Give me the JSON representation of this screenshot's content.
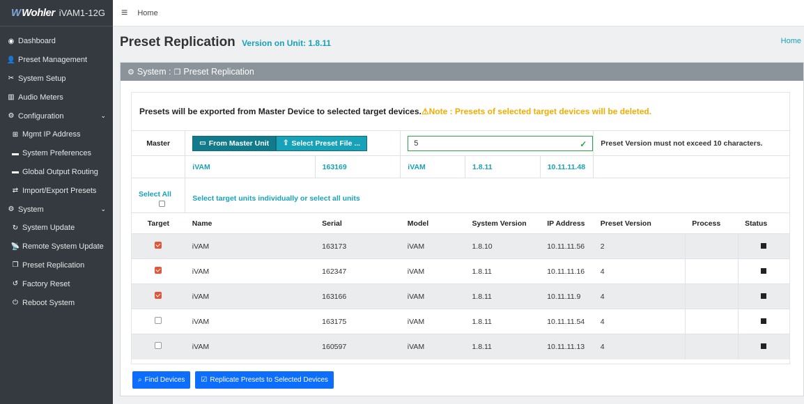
{
  "brand": {
    "logo_mark": "W",
    "logo_text": "Wohler",
    "unit": "iVAM1-12G"
  },
  "sidebar": {
    "items": [
      {
        "icon": "◉",
        "label": "Dashboard"
      },
      {
        "icon": "👤",
        "label": "Preset Management"
      },
      {
        "icon": "✂",
        "label": "System Setup"
      },
      {
        "icon": "▥",
        "label": "Audio Meters"
      },
      {
        "icon": "⚙",
        "label": "Configuration",
        "caret": "⌄"
      },
      {
        "icon": "⊞",
        "label": "Mgmt IP Address"
      },
      {
        "icon": "▬",
        "label": "System Preferences"
      },
      {
        "icon": "▬",
        "label": "Global Output Routing"
      },
      {
        "icon": "⇄",
        "label": "Import/Export Presets"
      },
      {
        "icon": "⚙",
        "label": "System",
        "caret": "⌄"
      },
      {
        "icon": "↻",
        "label": "System Update"
      },
      {
        "icon": "📡",
        "label": "Remote System Update"
      },
      {
        "icon": "❐",
        "label": "Preset Replication"
      },
      {
        "icon": "↺",
        "label": "Factory Reset"
      },
      {
        "icon": "⏻",
        "label": "Reboot System"
      }
    ]
  },
  "topbar": {
    "menu_icon": "≡",
    "breadcrumb": "Home"
  },
  "page": {
    "title": "Preset Replication",
    "version_label": "Version on Unit: 1.8.11",
    "home_link": "Home"
  },
  "card": {
    "header_prefix": "System :",
    "header_title": "Preset Replication"
  },
  "notice": {
    "text": "Presets will be exported from Master Device to selected target devices.",
    "warning": "⚠Note : Presets of selected target devices will be deleted."
  },
  "master": {
    "label": "Master",
    "from_master_button": "From Master Unit",
    "select_file_button": "Select Preset File ...",
    "version_value": "5",
    "valid_icon": "✓",
    "hint": "Preset Version must not exceed 10 characters.",
    "info": {
      "name": "iVAM",
      "serial": "163169",
      "model": "iVAM",
      "version": "1.8.11",
      "ip": "10.11.11.48"
    }
  },
  "select_all": {
    "label": "Select All",
    "text": "Select target units individually or select all units"
  },
  "table": {
    "headers": {
      "target": "Target",
      "name": "Name",
      "serial": "Serial",
      "model": "Model",
      "system_version": "System Version",
      "ip": "IP Address",
      "preset_version": "Preset Version",
      "process": "Process",
      "status": "Status"
    },
    "rows": [
      {
        "checked": true,
        "name": "iVAM",
        "serial": "163173",
        "model": "iVAM",
        "system_version": "1.8.10",
        "ip": "10.11.11.56",
        "preset_version": "2",
        "process": ""
      },
      {
        "checked": true,
        "name": "iVAM",
        "serial": "162347",
        "model": "iVAM",
        "system_version": "1.8.11",
        "ip": "10.11.11.16",
        "preset_version": "4",
        "process": ""
      },
      {
        "checked": true,
        "name": "iVAM",
        "serial": "163166",
        "model": "iVAM",
        "system_version": "1.8.11",
        "ip": "10.11.11.9",
        "preset_version": "4",
        "process": ""
      },
      {
        "checked": false,
        "name": "iVAM",
        "serial": "163175",
        "model": "iVAM",
        "system_version": "1.8.11",
        "ip": "10.11.11.54",
        "preset_version": "4",
        "process": ""
      },
      {
        "checked": false,
        "name": "iVAM",
        "serial": "160597",
        "model": "iVAM",
        "system_version": "1.8.11",
        "ip": "10.11.11.13",
        "preset_version": "4",
        "process": ""
      }
    ]
  },
  "actions": {
    "find_devices": "Find Devices",
    "replicate": "Replicate Presets to Selected Devices"
  },
  "colors": {
    "sidebar_bg": "#343a40",
    "accent": "#17a2b8",
    "primary": "#0d6efd",
    "warning": "#f0ad00",
    "checkbox": "#e0563a"
  }
}
